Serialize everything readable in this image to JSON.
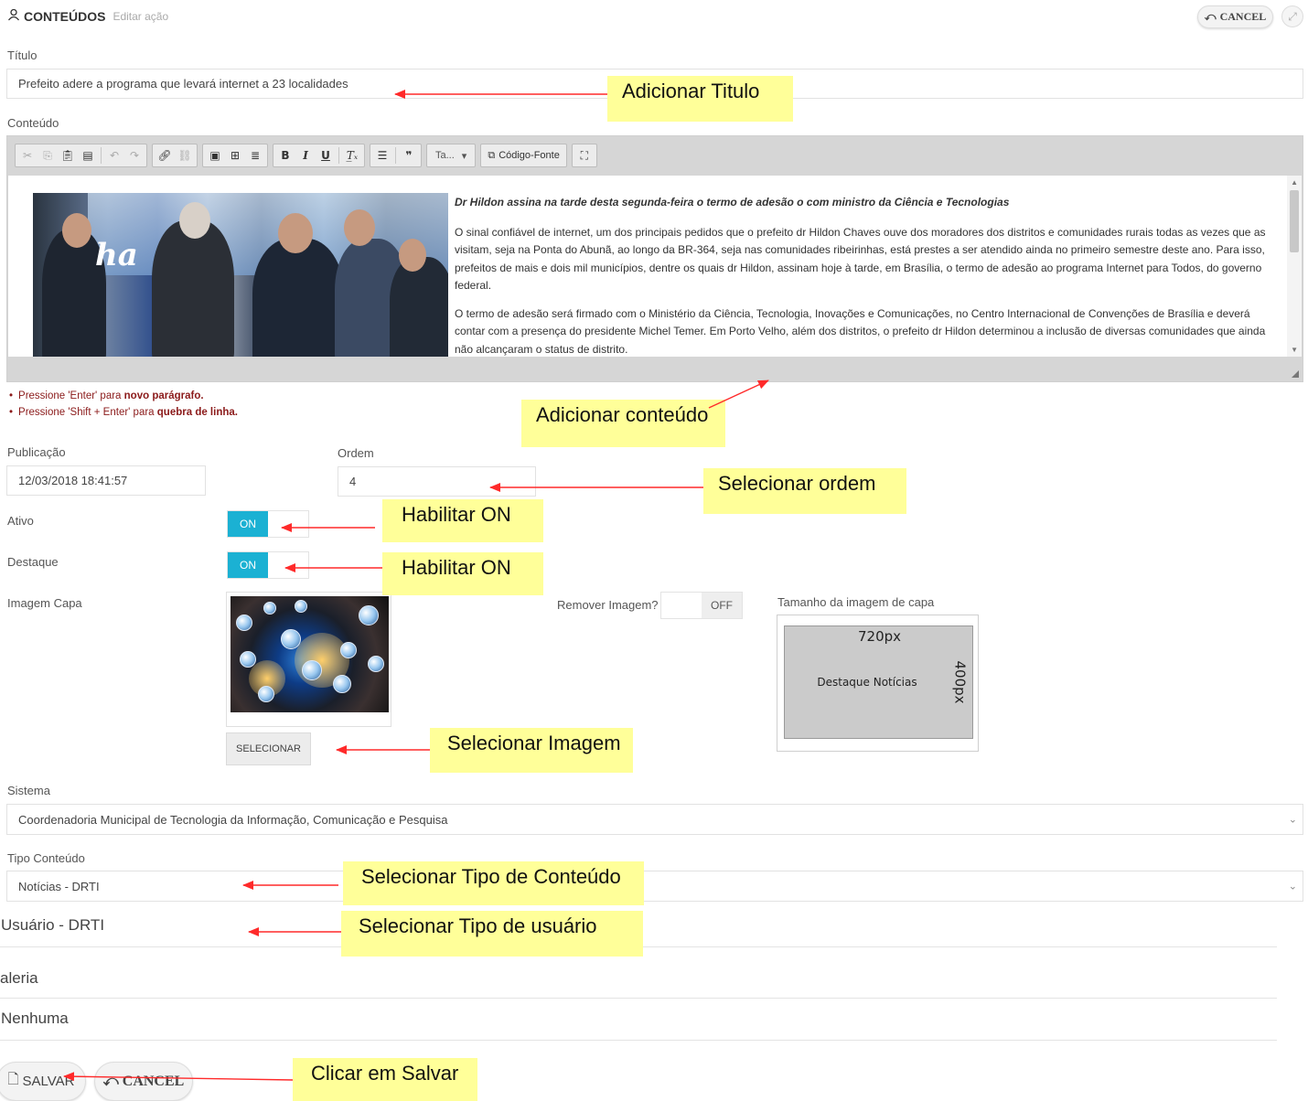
{
  "header": {
    "title": "CONTEÚDOS",
    "subtitle": "Editar ação",
    "cancel_label": "CANCEL"
  },
  "form": {
    "titulo_label": "Título",
    "titulo_value": "Prefeito adere a programa que levará internet a 23 localidades",
    "conteudo_label": "Conteúdo",
    "editor": {
      "toolbar": {
        "style_combo": "Ta...",
        "source_label": "Código-Fonte"
      },
      "lead": "Dr Hildon assina na tarde desta segunda-feira o termo de adesão o com ministro da Ciência e Tecnologias",
      "paragraph1": "O sinal confiável de internet, um dos principais pedidos que o prefeito dr Hildon Chaves ouve dos moradores dos distritos e comunidades rurais todas as vezes que as visitam, seja na Ponta do Abunã, ao longo da BR-364, seja nas comunidades ribeirinhas, está prestes a ser atendido ainda no primeiro semestre deste ano. Para isso, prefeitos de mais e dois mil municípios, dentre os quais dr Hildon, assinam hoje à tarde, em Brasília, o termo de adesão ao programa Internet para Todos, do governo federal.",
      "paragraph2": "O termo de adesão será firmado com o Ministério da Ciência, Tecnologia, Inovações e Comunicações, no Centro Internacional de Convenções de Brasília e deverá contar com a presença do presidente Michel Temer. Em Porto Velho, além dos distritos, o prefeito dr Hildon determinou a inclusão de diversas comunidades que ainda não alcançaram o status de distrito."
    },
    "hints": {
      "hint1_prefix": "Pressione 'Enter' para ",
      "hint1_bold": "novo parágrafo.",
      "hint2_prefix": "Pressione 'Shift + Enter' para ",
      "hint2_bold": "quebra de linha."
    },
    "publicacao_label": "Publicação",
    "publicacao_value": "12/03/2018 18:41:57",
    "ordem_label": "Ordem",
    "ordem_value": "4",
    "ativo_label": "Ativo",
    "ativo_state": "ON",
    "destaque_label": "Destaque",
    "destaque_state": "ON",
    "imagem_capa_label": "Imagem Capa",
    "selecionar_label": "SELECIONAR",
    "remover_imagem_label": "Remover Imagem?",
    "remover_state": "OFF",
    "tamanho_label": "Tamanho da imagem de capa",
    "size_example": {
      "width_text": "720px",
      "height_text": "400px",
      "center_text": "Destaque Notícias"
    },
    "sistema_label": "Sistema",
    "sistema_value": "Coordenadoria Municipal de Tecnologia da Informação, Comunicação e Pesquisa",
    "tipo_conteudo_label": "Tipo Conteúdo",
    "tipo_conteudo_value": "Notícias - DRTI",
    "usuario_value": "Usuário - DRTI",
    "galeria_label": "aleria",
    "galeria_value": "Nenhuma",
    "salvar_label": "SALVAR",
    "cancel_label": "CANCEL"
  },
  "annotations": {
    "titulo": "Adicionar Titulo",
    "conteudo": "Adicionar conteúdo",
    "ordem": "Selecionar ordem",
    "ativo": "Habilitar ON",
    "destaque": "Habilitar ON",
    "imagem": "Selecionar Imagem",
    "tipo_conteudo": "Selecionar Tipo de Conteúdo",
    "usuario": "Selecionar Tipo de usuário",
    "salvar": "Clicar em Salvar"
  },
  "colors": {
    "toggle_on": "#1bb1d3",
    "annotation_bg": "#ffff99",
    "arrow": "#ff2a2a",
    "hint_text": "#8b1a1a"
  }
}
